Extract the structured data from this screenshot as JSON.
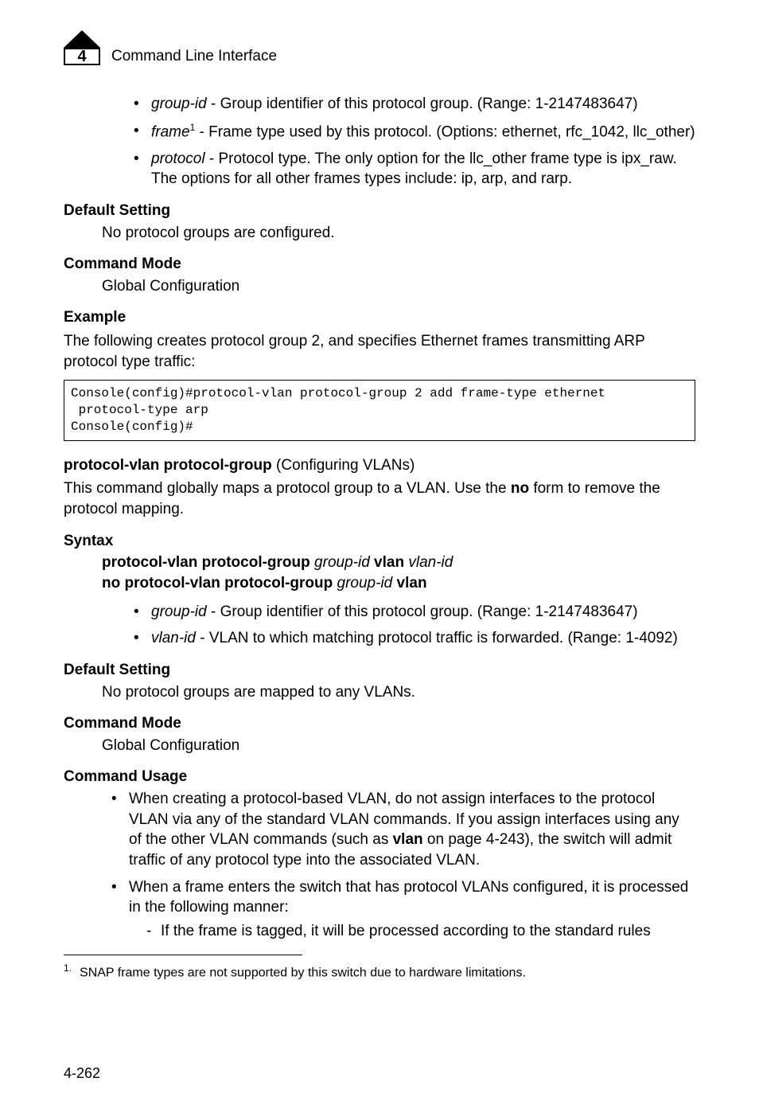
{
  "header": {
    "chapter_number": "4",
    "title": "Command Line Interface"
  },
  "bullets_top": [
    {
      "param": "group-id",
      "text": " - Group identifier of this protocol group. (Range: 1-2147483647)"
    },
    {
      "param": "frame",
      "sup": "1",
      "text": " - Frame type used by this protocol. (Options: ethernet, rfc_1042, llc_other)"
    },
    {
      "param": "protocol",
      "text": " - Protocol type. The only option for the llc_other frame type is ipx_raw. The options for all other frames types include: ip, arp, and rarp."
    }
  ],
  "sec1": {
    "default_head": "Default Setting",
    "default_body": "No protocol groups are configured.",
    "mode_head": "Command Mode",
    "mode_body": "Global Configuration",
    "example_head": "Example",
    "example_intro": "The following creates protocol group 2, and specifies Ethernet frames transmitting ARP protocol type traffic:",
    "code": "Console(config)#protocol-vlan protocol-group 2 add frame-type ethernet\n protocol-type arp\nConsole(config)#"
  },
  "cmd2": {
    "title_bold": "protocol-vlan protocol-group",
    "title_rest": " (Configuring VLANs)",
    "intro_a": "This command globally maps a protocol group to a VLAN. Use the ",
    "intro_no": "no",
    "intro_b": " form to remove the protocol mapping.",
    "syntax_head": "Syntax",
    "syntax_l1_a": "protocol-vlan protocol-group",
    "syntax_l1_b": "group-id",
    "syntax_l1_c": "vlan",
    "syntax_l1_d": "vlan-id",
    "syntax_l2_a": "no protocol-vlan protocol-group",
    "syntax_l2_b": "group-id",
    "syntax_l2_c": "vlan",
    "bullets": [
      {
        "param": "group-id",
        "text": " - Group identifier of this protocol group. (Range: 1-2147483647)"
      },
      {
        "param": "vlan-id",
        "text": " - VLAN to which matching protocol traffic is forwarded. (Range: 1-4092)"
      }
    ],
    "default_head": "Default Setting",
    "default_body": "No protocol groups are mapped to any VLANs.",
    "mode_head": "Command Mode",
    "mode_body": "Global Configuration",
    "usage_head": "Command Usage",
    "usage_b1_a": "When creating a protocol-based VLAN, do not assign interfaces to the protocol VLAN via any of the standard VLAN commands. If you assign interfaces using any of the other VLAN commands (such as ",
    "usage_b1_vlan": "vlan",
    "usage_b1_b": " on page 4-243), the switch will admit traffic of any protocol type into the associated VLAN.",
    "usage_b2": "When a frame enters the switch that has protocol VLANs configured, it is processed in the following manner:",
    "usage_b2_sub": "If the frame is tagged, it will be processed according to the standard rules"
  },
  "footnote": {
    "num": "1.",
    "text": "SNAP frame types are not supported by this switch due to hardware limitations."
  },
  "page_number": "4-262"
}
